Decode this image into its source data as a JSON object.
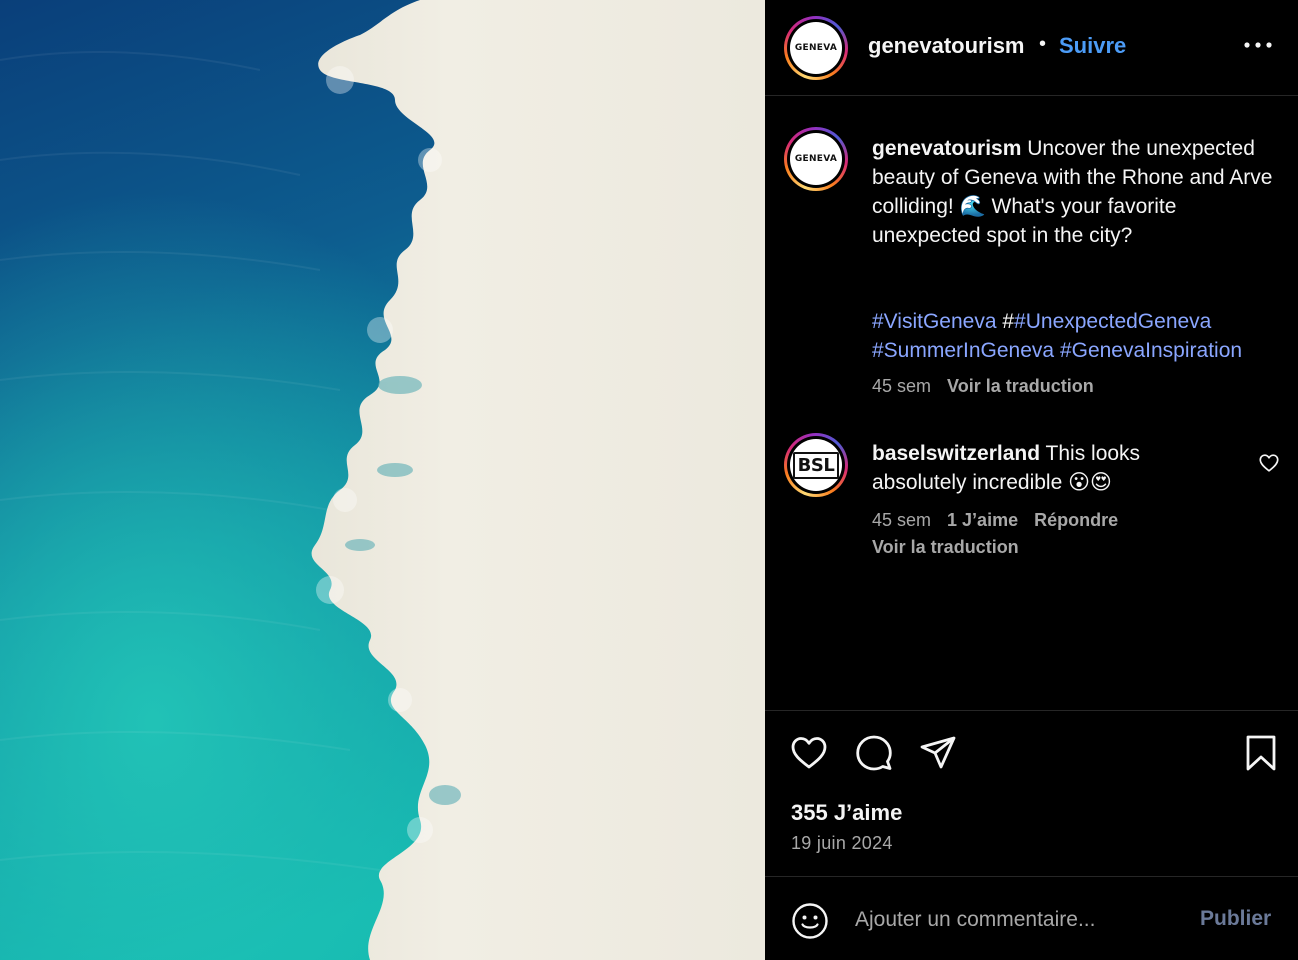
{
  "header": {
    "avatar_text": "GENEVA",
    "username": "genevatourism",
    "dot": "•",
    "follow_label": "Suivre"
  },
  "caption": {
    "avatar_text": "GENEVA",
    "username": "genevatourism",
    "text": " Uncover the unexpected beauty of Geneva with the Rhone and Arve colliding! 🌊 What's your favorite unexpected spot in the city?",
    "hashtags": [
      "#VisitGeneva",
      " #",
      "#UnexpectedGeneva",
      "#SummerInGeneva",
      " ",
      "#GenevaInspiration"
    ],
    "time": "45 sem",
    "translate": "Voir la traduction"
  },
  "comment": {
    "avatar_text": "BSL",
    "username": "baselswitzerland",
    "text": " This looks absolutely incredible 😮😍",
    "time": "45 sem",
    "likes": "1 J’aime",
    "reply": "Répondre",
    "translate": "Voir la traduction"
  },
  "actions": {
    "likes": "355 J’aime",
    "date": "19 juin 2024"
  },
  "comment_bar": {
    "placeholder": "Ajouter un commentaire...",
    "publish_label": "Publier"
  },
  "colors": {
    "background": "#000000",
    "link": "#4c9cf7",
    "hashtag": "#8aa6ff",
    "muted": "#a8a8a8",
    "divider": "#262626"
  },
  "icons": [
    "more-icon",
    "heart-icon",
    "comment-icon",
    "share-icon",
    "bookmark-icon",
    "emoji-icon"
  ]
}
